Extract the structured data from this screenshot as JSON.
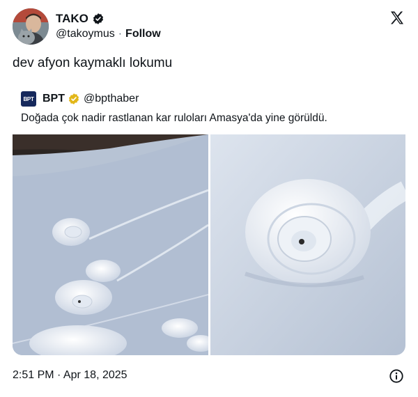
{
  "author": {
    "display_name": "TAKO",
    "handle": "@takoymus",
    "separator": "·",
    "follow_label": "Follow",
    "verified_icon": "verified-badge-icon"
  },
  "tweet": {
    "text": "dev afyon kaymaklı lokumu",
    "timestamp": "2:51 PM · Apr 18, 2025"
  },
  "quote": {
    "avatar_text": "BPT",
    "display_name": "BPT",
    "handle": "@bpthaber",
    "text": "Doğada çok nadir rastlanan kar ruloları Amasya'da yine görüldü.",
    "badge_icon": "gold-verified-badge-icon"
  },
  "colors": {
    "text": "#0f1419",
    "secondary": "#536471",
    "gold_badge": "#e2b719",
    "quote_avatar_bg": "#16295c"
  }
}
